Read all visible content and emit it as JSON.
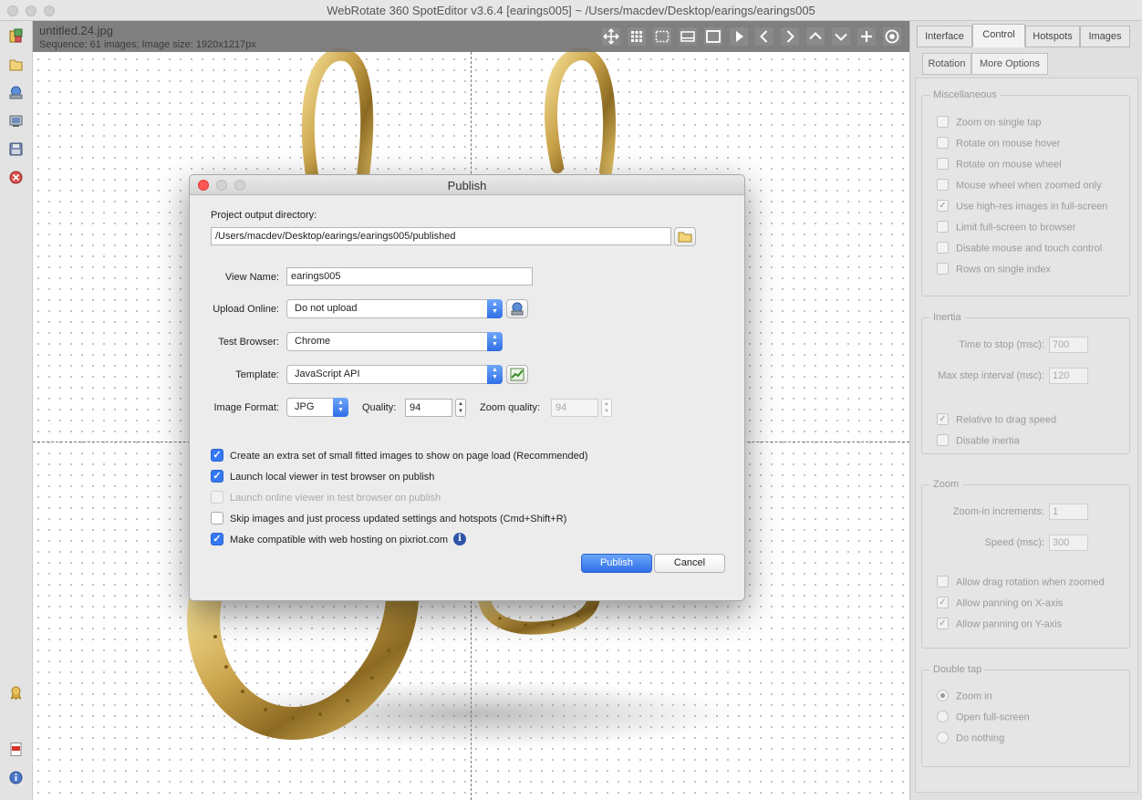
{
  "window": {
    "title": "WebRotate 360 SpotEditor v3.6.4 [earings005] ~ /Users/macdev/Desktop/earings/earings005"
  },
  "left_toolbar": {
    "icons": [
      "new-project-icon",
      "open-folder-icon",
      "upload-icon",
      "publish-icon",
      "save-icon",
      "close-project-icon",
      "badge-icon",
      "pdf-icon",
      "info-icon"
    ]
  },
  "viewer": {
    "file_name": "untitled.24.jpg",
    "sequence_info": "Sequence: 61 images; Image size: 1920x1217px",
    "toolbar_icons": [
      "move-icon",
      "grid-icon",
      "select-region-icon",
      "fit-width-icon",
      "fit-screen-icon",
      "play-icon",
      "prev-icon",
      "next-icon",
      "up-icon",
      "down-icon",
      "add-hotspot-icon",
      "target-icon"
    ],
    "colors": {
      "gold": "#c9a24a",
      "header": "#6e6e6e"
    }
  },
  "right_panel": {
    "tabs": [
      {
        "label": "Interface",
        "active": false
      },
      {
        "label": "Control",
        "active": true
      },
      {
        "label": "Hotspots",
        "active": false
      },
      {
        "label": "Images",
        "active": false
      }
    ],
    "subtabs": [
      {
        "label": "Rotation",
        "active": false
      },
      {
        "label": "More Options",
        "active": true
      }
    ],
    "miscellaneous": {
      "title": "Miscellaneous",
      "options": [
        {
          "label": "Zoom on single tap",
          "checked": false
        },
        {
          "label": "Rotate on mouse hover",
          "checked": false
        },
        {
          "label": "Rotate on mouse wheel",
          "checked": false
        },
        {
          "label": "Mouse wheel when zoomed only",
          "checked": false
        },
        {
          "label": "Use high-res images in full-screen",
          "checked": true
        },
        {
          "label": "Limit full-screen to browser",
          "checked": false
        },
        {
          "label": "Disable mouse and touch control",
          "checked": false
        },
        {
          "label": "Rows on single index",
          "checked": false
        }
      ]
    },
    "inertia": {
      "title": "Inertia",
      "time_to_stop_label": "Time to stop (msc):",
      "time_to_stop_value": "700",
      "max_step_label": "Max step interval (msc):",
      "max_step_value": "120",
      "options": [
        {
          "label": "Relative to drag speed",
          "checked": true
        },
        {
          "label": "Disable inertia",
          "checked": false
        }
      ]
    },
    "zoom": {
      "title": "Zoom",
      "increments_label": "Zoom-in increments:",
      "increments_value": "1",
      "speed_label": "Speed (msc):",
      "speed_value": "300",
      "options": [
        {
          "label": "Allow drag rotation when zoomed",
          "checked": false
        },
        {
          "label": "Allow panning on X-axis",
          "checked": true
        },
        {
          "label": "Allow panning on Y-axis",
          "checked": true
        }
      ]
    },
    "double_tap": {
      "title": "Double tap",
      "options": [
        {
          "label": "Zoom in",
          "selected": true
        },
        {
          "label": "Open full-screen",
          "selected": false
        },
        {
          "label": "Do nothing",
          "selected": false
        }
      ]
    }
  },
  "dialog": {
    "title": "Publish",
    "output_dir_label": "Project output directory:",
    "output_dir_value": "/Users/macdev/Desktop/earings/earings005/published",
    "view_name_label": "View Name:",
    "view_name_value": "earings005",
    "upload_online_label": "Upload Online:",
    "upload_online_value": "Do not upload",
    "test_browser_label": "Test Browser:",
    "test_browser_value": "Chrome",
    "template_label": "Template:",
    "template_value": "JavaScript API",
    "image_format_label": "Image Format:",
    "image_format_value": "JPG",
    "quality_label": "Quality:",
    "quality_value": "94",
    "zoom_quality_label": "Zoom quality:",
    "zoom_quality_value": "94",
    "checkboxes": [
      {
        "label": "Create an extra set of small fitted images to show on page load (Recommended)",
        "checked": true,
        "enabled": true
      },
      {
        "label": "Launch local viewer in test browser on publish",
        "checked": true,
        "enabled": true
      },
      {
        "label": "Launch online viewer in test browser on publish",
        "checked": false,
        "enabled": false
      },
      {
        "label": "Skip images and just process updated settings and hotspots (Cmd+Shift+R)",
        "checked": false,
        "enabled": true
      },
      {
        "label": "Make compatible with web hosting on pixriot.com",
        "checked": true,
        "enabled": true
      }
    ],
    "info_glyph": "i",
    "publish_label": "Publish",
    "cancel_label": "Cancel",
    "colors": {
      "accent": "#3478f6",
      "close": "#fc5753"
    }
  }
}
